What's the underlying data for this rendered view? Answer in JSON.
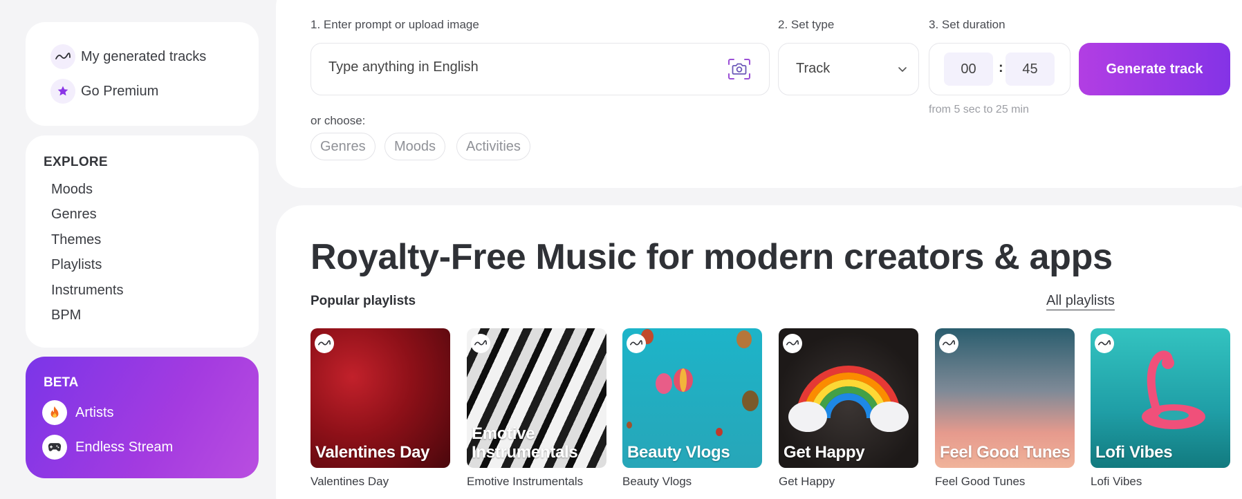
{
  "sidebar": {
    "user_links": [
      {
        "label": "My generated tracks",
        "icon": "wave-icon"
      },
      {
        "label": "Go Premium",
        "icon": "star-icon"
      }
    ],
    "explore": {
      "title": "EXPLORE",
      "items": [
        "Moods",
        "Genres",
        "Themes",
        "Playlists",
        "Instruments",
        "BPM"
      ]
    },
    "beta": {
      "title": "BETA",
      "items": [
        {
          "label": "Artists",
          "icon": "fire-icon"
        },
        {
          "label": "Endless Stream",
          "icon": "gamepad-icon"
        }
      ]
    }
  },
  "generator": {
    "step1_label": "1. Enter prompt or upload image",
    "prompt_placeholder": "Type anything in English",
    "step2_label": "2. Set type",
    "type_value": "Track",
    "step3_label": "3. Set duration",
    "duration_minutes": "00",
    "duration_separator": ":",
    "duration_seconds": "45",
    "duration_hint": "from 5 sec to 25 min",
    "generate_label": "Generate track",
    "or_choose": "or choose:",
    "chips": [
      "Genres",
      "Moods",
      "Activities"
    ]
  },
  "main": {
    "title": "Royalty-Free Music for modern creators & apps",
    "popular_label": "Popular playlists",
    "all_playlists_label": "All playlists",
    "playlists": [
      {
        "title": "Valentines Day",
        "overlay": "Valentines Day"
      },
      {
        "title": "Emotive Instrumentals",
        "overlay": "Emotive Instrumentals"
      },
      {
        "title": "Beauty Vlogs",
        "overlay": "Beauty Vlogs"
      },
      {
        "title": "Get Happy",
        "overlay": "Get Happy"
      },
      {
        "title": "Feel Good Tunes",
        "overlay": "Feel Good Tunes"
      },
      {
        "title": "Lofi Vibes",
        "overlay": "Lofi Vibes"
      }
    ]
  },
  "colors": {
    "accent": "#8a35e6",
    "accent_light": "#b23ee3",
    "page_bg": "#f4f4f6",
    "text": "#2f3136"
  }
}
